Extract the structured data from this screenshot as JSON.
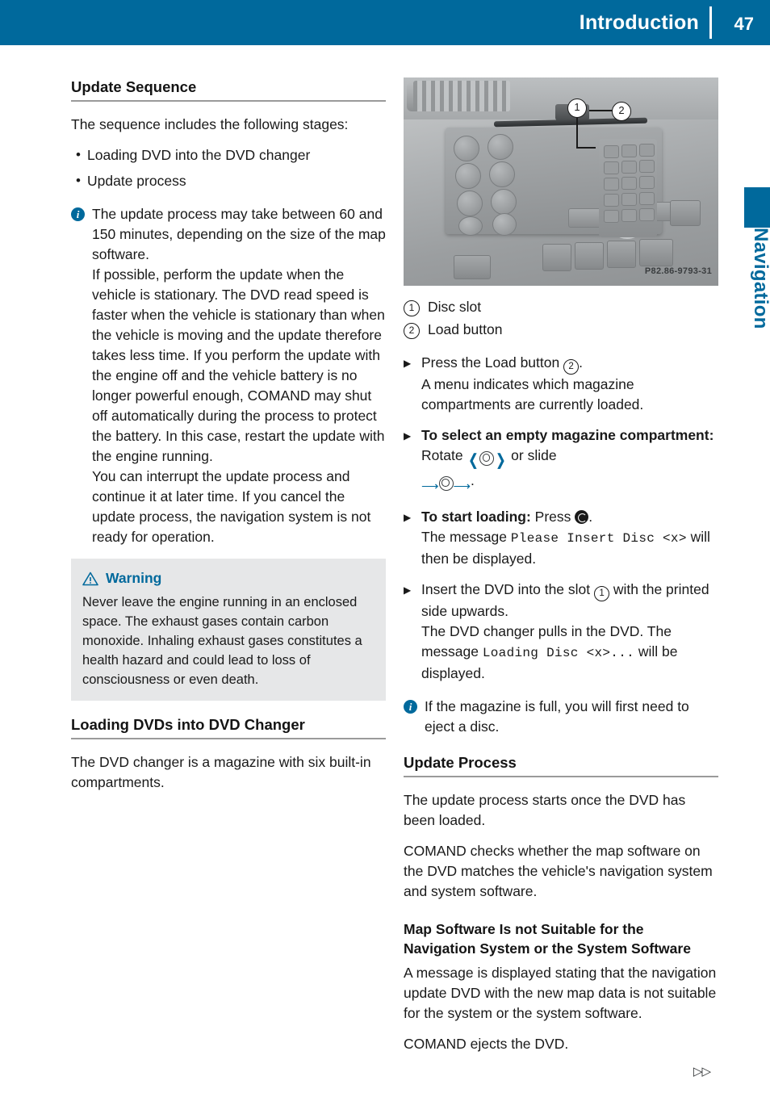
{
  "header": {
    "title": "Introduction",
    "page_number": "47"
  },
  "side_tab": {
    "label": "Navigation"
  },
  "left_column": {
    "section_heading": "Update Sequence",
    "intro": "The sequence includes the following stages:",
    "bullets": [
      "Loading DVD into the DVD changer",
      "Update process"
    ],
    "note_paragraphs": [
      "The update process may take between 60 and 150 minutes, depending on the size of the map software.",
      "If possible, perform the update when the vehicle is stationary. The DVD read speed is faster when the vehicle is stationary than when the vehicle is moving and the update therefore takes less time. If you perform the update with the engine off and the vehicle battery is no longer powerful enough, COMAND may shut off automatically during the process to protect the battery. In this case, restart the update with the engine running.",
      "You can interrupt the update process and continue it at later time. If you cancel the update process, the navigation system is not ready for operation."
    ],
    "warning": {
      "title": "Warning",
      "text": "Never leave the engine running in an enclosed space. The exhaust gases contain carbon monoxide. Inhaling exhaust gases constitutes a health hazard and could lead to loss of consciousness or even death."
    },
    "second_heading": "Loading DVDs into DVD Changer",
    "second_paragraph": "The DVD changer is a magazine with six built-in compartments."
  },
  "figure": {
    "code": "P82.86-9793-31",
    "callout_1": "1",
    "callout_2": "2"
  },
  "right_column": {
    "legend": [
      {
        "num": "1",
        "label": "Disc slot"
      },
      {
        "num": "2",
        "label": "Load button"
      }
    ],
    "steps": [
      {
        "id": "press-load",
        "lead": "Press the Load button",
        "callout": "2",
        "lead_tail": ".",
        "result": "A menu indicates which magazine compartments are currently loaded."
      },
      {
        "id": "select-compartment",
        "bold": "To select an empty magazine compartment:",
        "text_before_rotate": " Rotate ",
        "text_middle": " or slide ",
        "text_after": "."
      },
      {
        "id": "start-loading",
        "bold": "To start loading:",
        "text_press": " Press ",
        "text_after_press": ".",
        "result_prefix": "The message ",
        "result_mono": "Please Insert Disc <x>",
        "result_suffix": " will then be displayed."
      },
      {
        "id": "insert-dvd",
        "lead": "Insert the DVD into the slot",
        "callout": "1",
        "lead_tail": " with the printed side upwards.",
        "result_prefix": "The DVD changer pulls in the DVD. The message ",
        "result_mono": "Loading Disc <x>...",
        "result_suffix": " will be displayed."
      }
    ],
    "note": "If the magazine is full, you will first need to eject a disc.",
    "update_process_heading": "Update Process",
    "update_process_paragraphs": [
      "The update process starts once the DVD has been loaded.",
      "COMAND checks whether the map software on the DVD matches the vehicle's navigation system and system software."
    ],
    "map_software_heading": "Map Software Is not Suitable for the Navigation System or the System Software",
    "map_software_paragraphs": [
      "A message is displayed stating that the navigation update DVD with the new map data is not suitable for the system or the system software.",
      "COMAND ejects the DVD."
    ]
  },
  "footer": {
    "continue_marker": "▷▷"
  },
  "colors": {
    "brand_blue": "#00699c",
    "warning_bg": "#e6e7e8",
    "rule_gray": "#9a9a9a"
  }
}
